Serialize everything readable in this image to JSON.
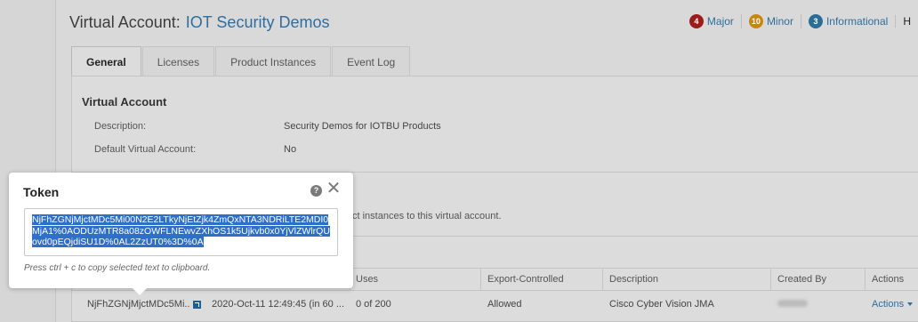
{
  "virtual_account": {
    "title_prefix": "Virtual Account:",
    "name": "IOT Security Demos"
  },
  "alerts": [
    {
      "count": "4",
      "label": "Major",
      "color": "#9e1b1b"
    },
    {
      "count": "10",
      "label": "Minor",
      "color": "#c8860f"
    },
    {
      "count": "3",
      "label": "Informational",
      "color": "#2a6d99"
    },
    {
      "label": "H"
    }
  ],
  "tabs": [
    {
      "label": "General",
      "active": true
    },
    {
      "label": "Licenses"
    },
    {
      "label": "Product Instances"
    },
    {
      "label": "Event Log"
    }
  ],
  "general": {
    "section_title": "Virtual Account",
    "description_label": "Description:",
    "description_value": "Security Demos for IOTBU Products",
    "default_label": "Default Virtual Account:",
    "default_value": "No",
    "instances_note": "ct instances to this virtual account."
  },
  "table": {
    "headers": [
      "Uses",
      "Export-Controlled",
      "Description",
      "Created By",
      "Actions"
    ],
    "row": {
      "token": "NjFhZGNjMjctMDc5Mi..",
      "expiration": "2020-Oct-11 12:49:45 (in 60 ...",
      "uses": "0 of 200",
      "export_controlled": "Allowed",
      "description": "Cisco Cyber Vision JMA",
      "actions": "Actions"
    }
  },
  "token_popover": {
    "title": "Token",
    "token": "NjFhZGNjMjctMDc5Mi00N2E2LTkyNjEtZjk4ZmQxNTA3NDRiLTE2MDI0MjA1%0AODUzMTR8a08zOWFLNEwvZXhOS1k5Ujkvb0x0YjVlZWlrQUovd0pEQjdiSU1D%0AL2ZzUT0%3D%0A",
    "hint": "Press ctrl + c to copy selected text to clipboard."
  }
}
